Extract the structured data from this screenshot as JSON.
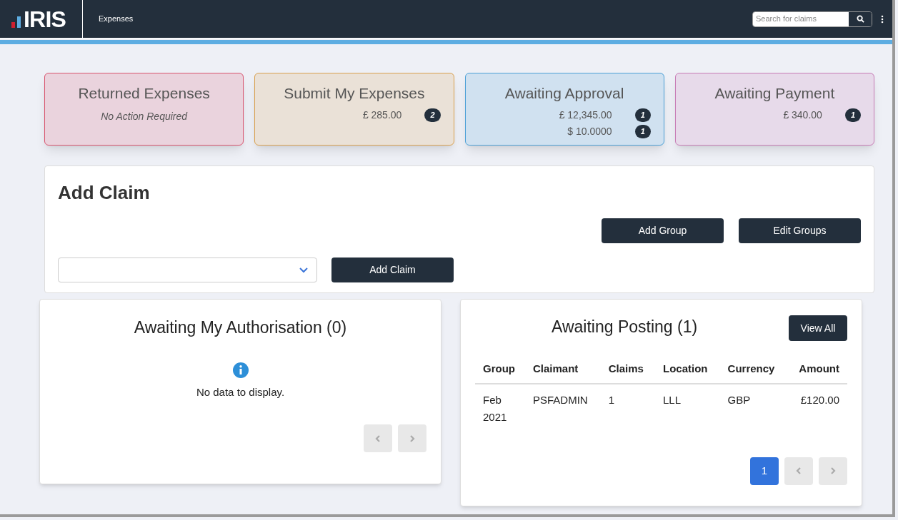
{
  "header": {
    "app_name": "IRIS",
    "section": "Expenses",
    "search": {
      "placeholder": "Search for claims"
    }
  },
  "summary_cards": [
    {
      "title": "Returned Expenses",
      "color": "#d9546e",
      "note": "No Action Required"
    },
    {
      "title": "Submit My Expenses",
      "color": "#d9a04e",
      "amounts": [
        {
          "value": "£ 285.00",
          "count": "2"
        }
      ]
    },
    {
      "title": "Awaiting Approval",
      "color": "#4a9fd6",
      "amounts": [
        {
          "value": "£ 12,345.00",
          "count": "1"
        },
        {
          "value": "$ 10.0000",
          "count": "1"
        }
      ]
    },
    {
      "title": "Awaiting Payment",
      "color": "#c77bb5",
      "amounts": [
        {
          "value": "£ 340.00",
          "count": "1"
        }
      ]
    }
  ],
  "add_claim": {
    "title": "Add Claim",
    "buttons": [
      "Add Group",
      "Edit Groups"
    ],
    "submit": "Add Claim"
  },
  "authorisation": {
    "title": "Awaiting My Authorisation (0)",
    "empty_message": "No data to display."
  },
  "posting": {
    "title": "Awaiting Posting (1)",
    "view_all": "View All",
    "columns": [
      "Group",
      "Claimant",
      "Claims",
      "Location",
      "Currency",
      "Amount"
    ],
    "rows": [
      [
        "Feb 2021",
        "PSFADMIN",
        "1",
        "LLL",
        "GBP",
        "£120.00"
      ]
    ],
    "pages": [
      {
        "label": "1",
        "selected": true
      }
    ]
  }
}
